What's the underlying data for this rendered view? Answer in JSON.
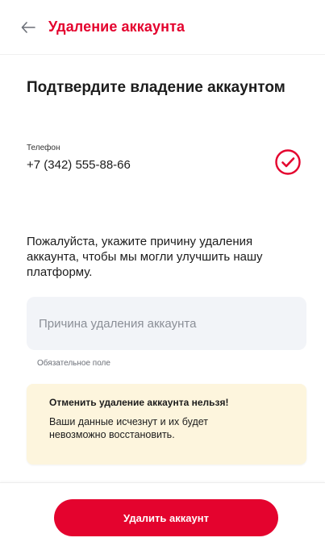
{
  "header": {
    "title": "Удаление аккаунта",
    "back_icon": "arrow-left-icon"
  },
  "main": {
    "title": "Подтвердите владение аккаунтом",
    "phone_label": "Телефон",
    "phone_value": "+7 (342) 555-88-66",
    "verified_icon": "check-circle-icon",
    "reason_text": "Пожалуйста, укажите причину удаления аккаунта, чтобы мы могли улучшить нашу платформу.",
    "reason_input": {
      "placeholder": "Причина удаления аккаунта",
      "value": ""
    },
    "required_hint": "Обязательное поле",
    "warning": {
      "title": "Отменить удаление аккаунта нельзя!",
      "text": "Ваши данные исчезнут и их будет невозможно восстановить."
    }
  },
  "footer": {
    "delete_button": "Удалить аккаунт"
  },
  "colors": {
    "accent": "#e4032e",
    "warning_bg": "#fdf5dd",
    "input_bg": "#f2f4f8"
  }
}
